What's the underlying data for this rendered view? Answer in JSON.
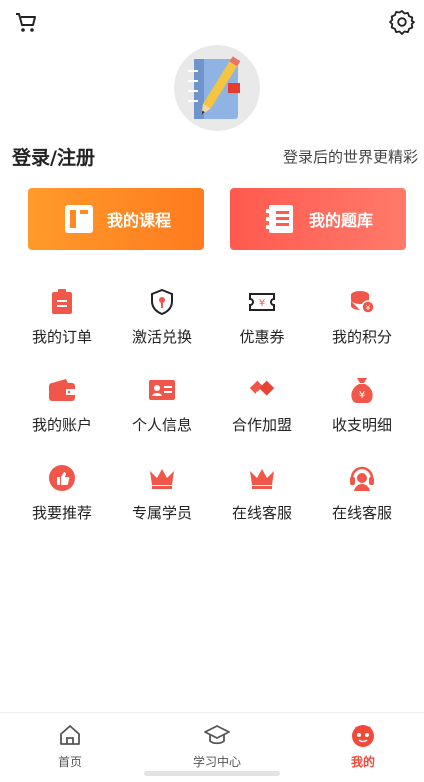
{
  "header": {
    "cart_icon": "cart-icon",
    "settings_icon": "gear-icon"
  },
  "profile": {
    "avatar_icon": "notebook-pencil-avatar",
    "login_label": "登录/注册",
    "hint": "登录后的世界更精彩"
  },
  "actions": {
    "course_label": "我的课程",
    "bank_label": "我的题库"
  },
  "menu": [
    {
      "label": "我的订单",
      "icon": "clipboard-icon"
    },
    {
      "label": "激活兑换",
      "icon": "shield-key-icon"
    },
    {
      "label": "优惠券",
      "icon": "coupon-icon"
    },
    {
      "label": "我的积分",
      "icon": "coins-icon"
    },
    {
      "label": "我的账户",
      "icon": "wallet-icon"
    },
    {
      "label": "个人信息",
      "icon": "id-card-icon"
    },
    {
      "label": "合作加盟",
      "icon": "handshake-icon"
    },
    {
      "label": "收支明细",
      "icon": "money-bag-icon"
    },
    {
      "label": "我要推荐",
      "icon": "thumbs-up-icon"
    },
    {
      "label": "专属学员",
      "icon": "crown-icon"
    },
    {
      "label": "在线客服",
      "icon": "crown-icon"
    },
    {
      "label": "在线客服",
      "icon": "headset-icon"
    }
  ],
  "tabbar": {
    "items": [
      {
        "label": "首页",
        "icon": "home-icon"
      },
      {
        "label": "学习中心",
        "icon": "graduation-cap-icon"
      },
      {
        "label": "我的",
        "icon": "mascot-icon"
      }
    ]
  },
  "colors": {
    "accent": "#f04a3a",
    "orange": "#ff8a24",
    "icon_red": "#f0574a"
  }
}
